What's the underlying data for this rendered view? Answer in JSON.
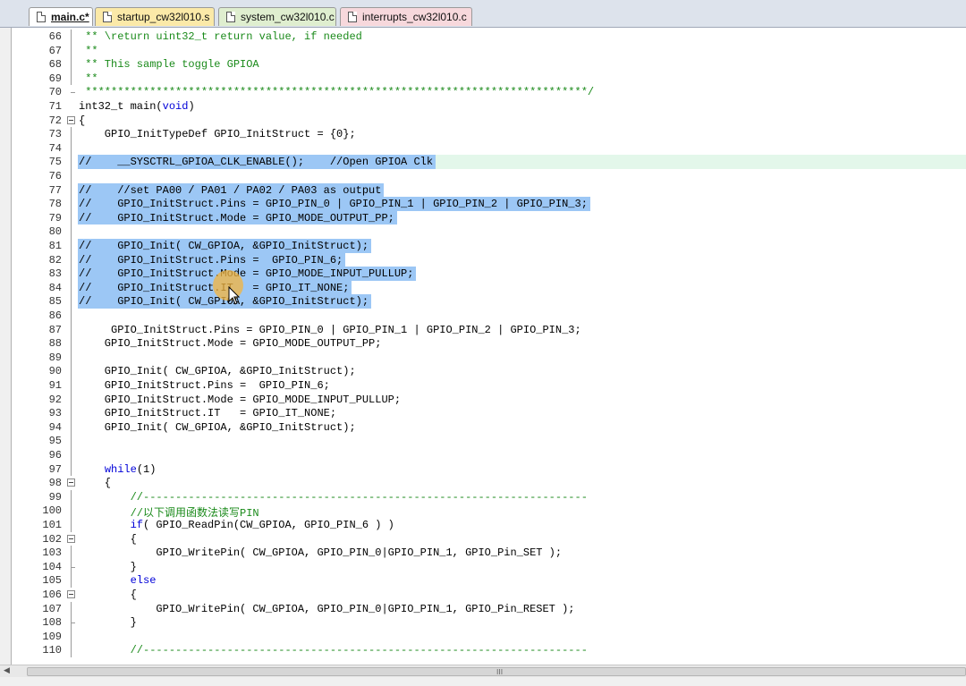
{
  "tabs": [
    {
      "label": "main.c*",
      "active": true,
      "color": "#ffffff"
    },
    {
      "label": "startup_cw32l010.s",
      "active": false,
      "color": "#fbe9a8"
    },
    {
      "label": "system_cw32l010.c",
      "active": false,
      "color": "#dfeecf"
    },
    {
      "label": "interrupts_cw32l010.c",
      "active": false,
      "color": "#f7d8dc"
    }
  ],
  "editor": {
    "lines": [
      {
        "num": "66",
        "text": " ** \\return uint32_t return value, if needed",
        "style": "green"
      },
      {
        "num": "67",
        "text": " **",
        "style": "green"
      },
      {
        "num": "68",
        "text": " ** This sample toggle GPIOA",
        "style": "green"
      },
      {
        "num": "69",
        "text": " **",
        "style": "green"
      },
      {
        "num": "70",
        "text": " ******************************************************************************/",
        "style": "green"
      },
      {
        "num": "71",
        "text": "int32_t main(void)",
        "style": "plain"
      },
      {
        "num": "72",
        "text": "{",
        "style": "plain"
      },
      {
        "num": "73",
        "text": "    GPIO_InitTypeDef GPIO_InitStruct = {0};",
        "style": "plain"
      },
      {
        "num": "74",
        "text": "",
        "style": "plain"
      },
      {
        "num": "75",
        "text": "//    __SYSCTRL_GPIOA_CLK_ENABLE();    //Open GPIOA Clk",
        "style": "plain"
      },
      {
        "num": "76",
        "text": "",
        "style": "plain"
      },
      {
        "num": "77",
        "text": "//    //set PA00 / PA01 / PA02 / PA03 as output",
        "style": "plain"
      },
      {
        "num": "78",
        "text": "//    GPIO_InitStruct.Pins = GPIO_PIN_0 | GPIO_PIN_1 | GPIO_PIN_2 | GPIO_PIN_3;",
        "style": "plain"
      },
      {
        "num": "79",
        "text": "//    GPIO_InitStruct.Mode = GPIO_MODE_OUTPUT_PP;",
        "style": "plain"
      },
      {
        "num": "80",
        "text": "",
        "style": "plain"
      },
      {
        "num": "81",
        "text": "//    GPIO_Init( CW_GPIOA, &GPIO_InitStruct);",
        "style": "plain"
      },
      {
        "num": "82",
        "text": "//    GPIO_InitStruct.Pins =  GPIO_PIN_6;",
        "style": "plain"
      },
      {
        "num": "83",
        "text": "//    GPIO_InitStruct.Mode = GPIO_MODE_INPUT_PULLUP;",
        "style": "plain"
      },
      {
        "num": "84",
        "text": "//    GPIO_InitStruct.IT   = GPIO_IT_NONE;",
        "style": "plain"
      },
      {
        "num": "85",
        "text": "//    GPIO_Init( CW_GPIOA, &GPIO_InitStruct);",
        "style": "plain"
      },
      {
        "num": "86",
        "text": "",
        "style": "plain"
      },
      {
        "num": "87",
        "text": "     GPIO_InitStruct.Pins = GPIO_PIN_0 | GPIO_PIN_1 | GPIO_PIN_2 | GPIO_PIN_3;",
        "style": "plain"
      },
      {
        "num": "88",
        "text": "    GPIO_InitStruct.Mode = GPIO_MODE_OUTPUT_PP;",
        "style": "plain"
      },
      {
        "num": "89",
        "text": "",
        "style": "plain"
      },
      {
        "num": "90",
        "text": "    GPIO_Init( CW_GPIOA, &GPIO_InitStruct);",
        "style": "plain"
      },
      {
        "num": "91",
        "text": "    GPIO_InitStruct.Pins =  GPIO_PIN_6;",
        "style": "plain"
      },
      {
        "num": "92",
        "text": "    GPIO_InitStruct.Mode = GPIO_MODE_INPUT_PULLUP;",
        "style": "plain"
      },
      {
        "num": "93",
        "text": "    GPIO_InitStruct.IT   = GPIO_IT_NONE;",
        "style": "plain"
      },
      {
        "num": "94",
        "text": "    GPIO_Init( CW_GPIOA, &GPIO_InitStruct);",
        "style": "plain"
      },
      {
        "num": "95",
        "text": "",
        "style": "plain"
      },
      {
        "num": "96",
        "text": "",
        "style": "plain"
      },
      {
        "num": "97",
        "text": "    while(1)",
        "style": "while"
      },
      {
        "num": "98",
        "text": "    {",
        "style": "plain"
      },
      {
        "num": "99",
        "text": "        //---------------------------------------------------------------------",
        "style": "green"
      },
      {
        "num": "100",
        "text": "        //以下调用函数法读写PIN",
        "style": "green"
      },
      {
        "num": "101",
        "text": "        if( GPIO_ReadPin(CW_GPIOA, GPIO_PIN_6 ) )",
        "style": "if"
      },
      {
        "num": "102",
        "text": "        {",
        "style": "plain"
      },
      {
        "num": "103",
        "text": "            GPIO_WritePin( CW_GPIOA, GPIO_PIN_0|GPIO_PIN_1, GPIO_Pin_SET );",
        "style": "plain"
      },
      {
        "num": "104",
        "text": "        }",
        "style": "plain"
      },
      {
        "num": "105",
        "text": "        else",
        "style": "kw"
      },
      {
        "num": "106",
        "text": "        {",
        "style": "plain"
      },
      {
        "num": "107",
        "text": "            GPIO_WritePin( CW_GPIOA, GPIO_PIN_0|GPIO_PIN_1, GPIO_Pin_RESET );",
        "style": "plain"
      },
      {
        "num": "108",
        "text": "        }",
        "style": "plain"
      },
      {
        "num": "109",
        "text": "",
        "style": "plain"
      },
      {
        "num": "110",
        "text": "        //---------------------------------------------------------------------",
        "style": "green"
      }
    ],
    "selected_lines": [
      "75",
      "77",
      "78",
      "79",
      "81",
      "82",
      "83",
      "84",
      "85"
    ],
    "current_line": "75",
    "fold_lines": [
      "72",
      "98",
      "102",
      "106"
    ]
  },
  "scrollbar": {
    "grip": "III",
    "left_arrow": "◀"
  },
  "colors": {
    "selection": "#9cc7f5",
    "current_line": "#e3f7ea",
    "comment": "#1a8a1a",
    "keyword": "#0000d8"
  }
}
